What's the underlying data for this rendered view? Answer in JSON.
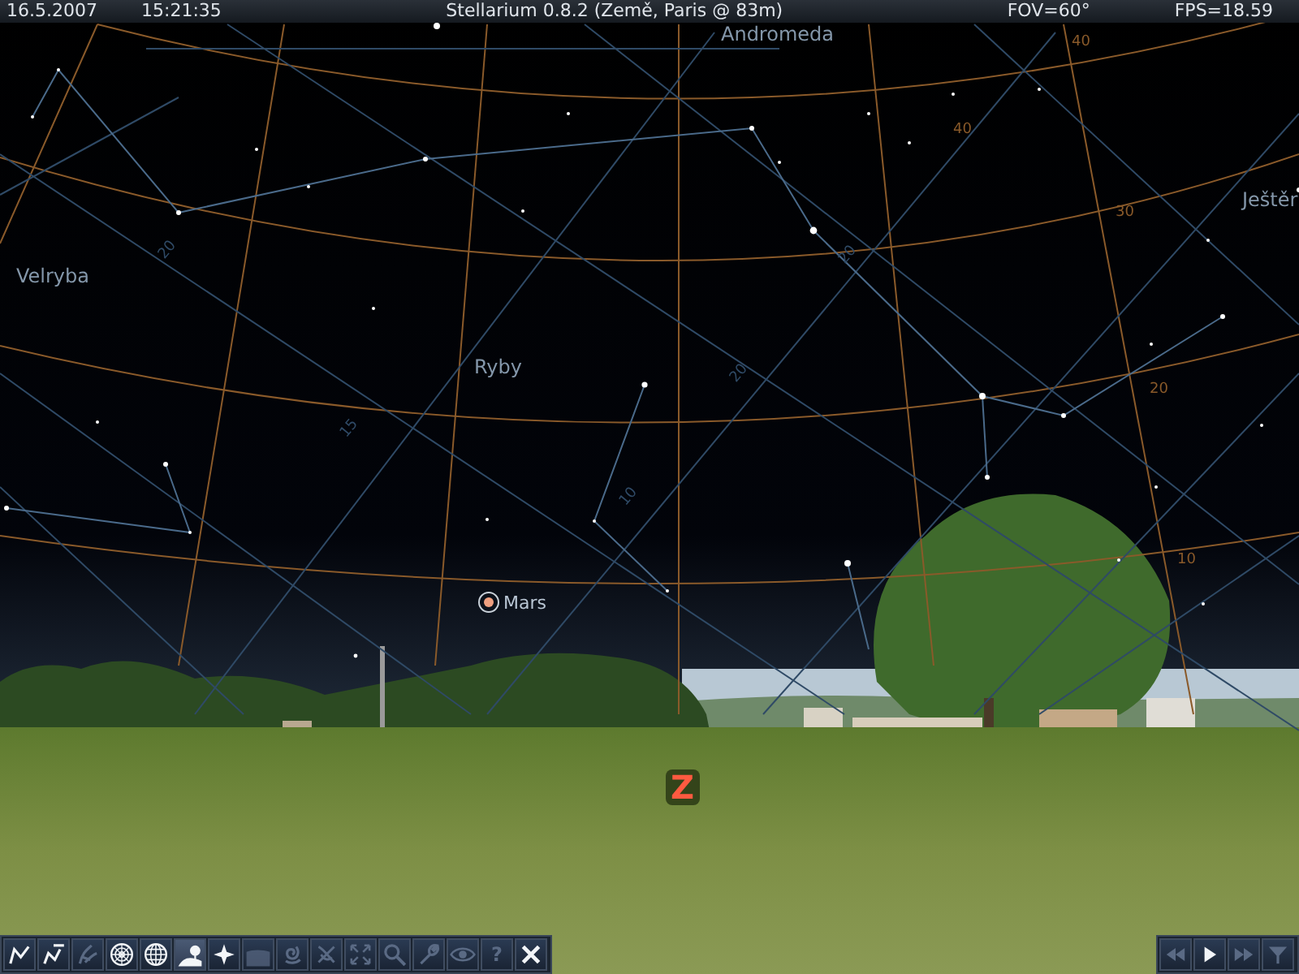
{
  "top_bar": {
    "date": "16.5.2007",
    "time": "15:21:35",
    "title": "Stellarium 0.8.2 (Země, Paris @ 83m)",
    "fov": "FOV=60°",
    "fps": "FPS=18.59"
  },
  "sky": {
    "constellation_labels": [
      "Andromeda",
      "Velryba",
      "Ryby",
      "Ještěr"
    ],
    "grid_labels": [
      {
        "text": "40",
        "kind": "altitude"
      },
      {
        "text": "40",
        "kind": "altitude"
      },
      {
        "text": "30",
        "kind": "altitude"
      },
      {
        "text": "20",
        "kind": "altitude"
      },
      {
        "text": "10",
        "kind": "altitude"
      },
      {
        "text": "20",
        "kind": "equatorial"
      },
      {
        "text": "15",
        "kind": "equatorial"
      },
      {
        "text": "10",
        "kind": "equatorial"
      },
      {
        "text": "20",
        "kind": "equatorial"
      },
      {
        "text": "20",
        "kind": "equatorial"
      }
    ],
    "planet_label": "Mars",
    "cardinal_point": "Z"
  },
  "toolbar": [
    {
      "kind": "constellation_lines",
      "on": true
    },
    {
      "kind": "constellation_names",
      "on": true
    },
    {
      "kind": "constellation_art",
      "on": false
    },
    {
      "kind": "azimuth_grid",
      "on": true
    },
    {
      "kind": "equatorial_grid",
      "on": true
    },
    {
      "kind": "ground",
      "on": true
    },
    {
      "kind": "cardinal_points",
      "on": true
    },
    {
      "kind": "atmosphere",
      "on": false
    },
    {
      "kind": "nebulae",
      "on": false
    },
    {
      "kind": "planets",
      "on": false
    },
    {
      "kind": "fullscreen",
      "on": false
    },
    {
      "kind": "search",
      "on": false
    },
    {
      "kind": "settings",
      "on": false
    },
    {
      "kind": "night_mode",
      "on": false
    },
    {
      "kind": "help",
      "on": false,
      "label": "?"
    },
    {
      "kind": "quit",
      "on": true
    }
  ],
  "time_controls": [
    {
      "kind": "rewind",
      "on": false
    },
    {
      "kind": "play",
      "on": true
    },
    {
      "kind": "forward",
      "on": false
    },
    {
      "kind": "real_time",
      "on": false
    }
  ]
}
